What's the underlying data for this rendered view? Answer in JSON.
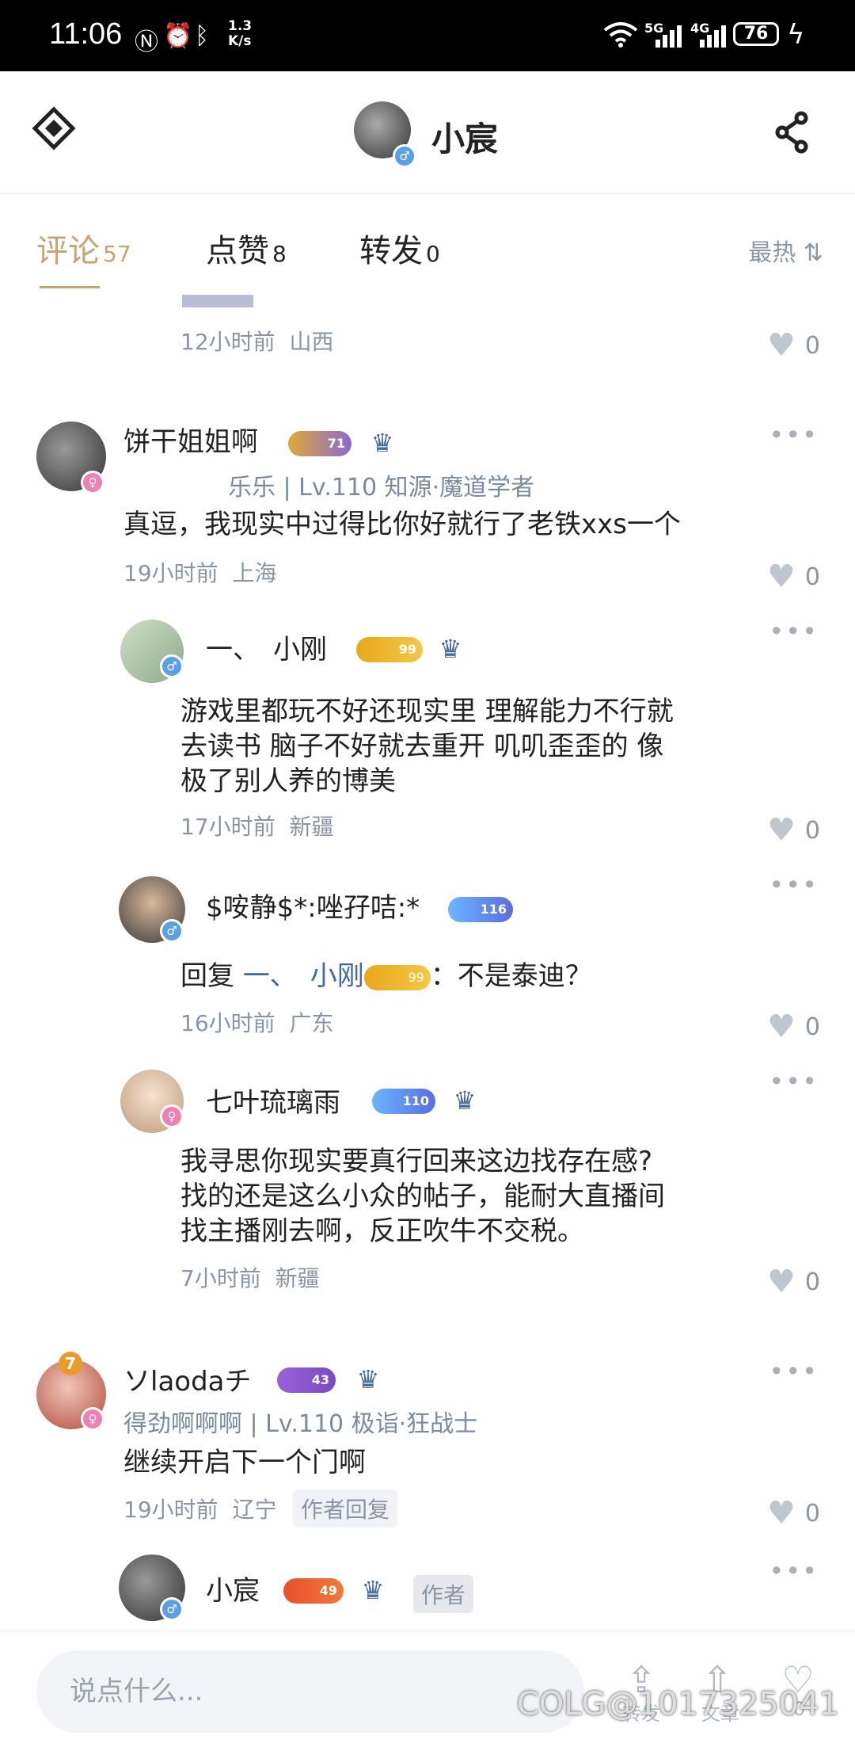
{
  "status_bar": {
    "time": "11:06",
    "net_speed_value": "1.3",
    "net_speed_unit": "K/s",
    "signal_5g": "5G",
    "signal_4g": "4G",
    "battery": "76"
  },
  "header": {
    "title": "小宸"
  },
  "tabs": [
    {
      "label": "评论",
      "count": "57"
    },
    {
      "label": "点赞",
      "count": "8"
    },
    {
      "label": "转发",
      "count": "0"
    }
  ],
  "sort_label": "最热",
  "prev_comment": {
    "time": "12小时前",
    "location": "山西",
    "likes": "0"
  },
  "comments": [
    {
      "username": "饼干姐姐啊",
      "level": "71",
      "subtitle": "乐乐 | Lv.110 知源·魔道学者",
      "content": "真逗，我现实中过得比你好就行了老铁xxs一个",
      "time": "19小时前",
      "location": "上海",
      "likes": "0",
      "replies": [
        {
          "username": "一、　小刚",
          "level": "99",
          "content_lines": [
            "游戏里都玩不好还现实里 理解能力不行就",
            "去读书 脑子不好就去重开 叽叽歪歪的 像",
            "极了别人养的博美"
          ],
          "time": "17小时前",
          "location": "新疆",
          "likes": "0"
        },
        {
          "username": "$咹静$*:唑孖咭:*",
          "level": "116",
          "reply_prefix": "回复",
          "reply_to": "一、　小刚",
          "reply_to_level": "99",
          "reply_text": "：不是泰迪？",
          "time": "16小时前",
          "location": "广东",
          "likes": "0"
        },
        {
          "username": "七叶琉璃雨",
          "level": "110",
          "content_lines": [
            "我寻思你现实要真行回来这边找存在感?",
            "找的还是这么小众的帖子，能耐大直播间",
            "找主播刚去啊，反正吹牛不交税。"
          ],
          "time": "7小时前",
          "location": "新疆",
          "likes": "0"
        }
      ]
    },
    {
      "username": "ソlaodaチ",
      "level": "43",
      "avatar_level": "7",
      "subtitle": "得劲啊啊啊 | Lv.110 极诣·狂战士",
      "content": "继续开启下一个门啊",
      "time": "19小时前",
      "location": "辽宁",
      "tag": "作者回复",
      "likes": "0",
      "replies": [
        {
          "username": "小宸",
          "level": "49",
          "tag": "作者"
        }
      ]
    }
  ],
  "bottom_bar": {
    "placeholder": "说点什么...",
    "labels": [
      "转发",
      "文章",
      "0"
    ]
  },
  "watermark": "COLG@1017325041",
  "icons": [
    "logo-icon",
    "share-node-icon",
    "sort-icon",
    "heart-icon",
    "more-dots-icon",
    "forward-icon",
    "upload-icon"
  ]
}
